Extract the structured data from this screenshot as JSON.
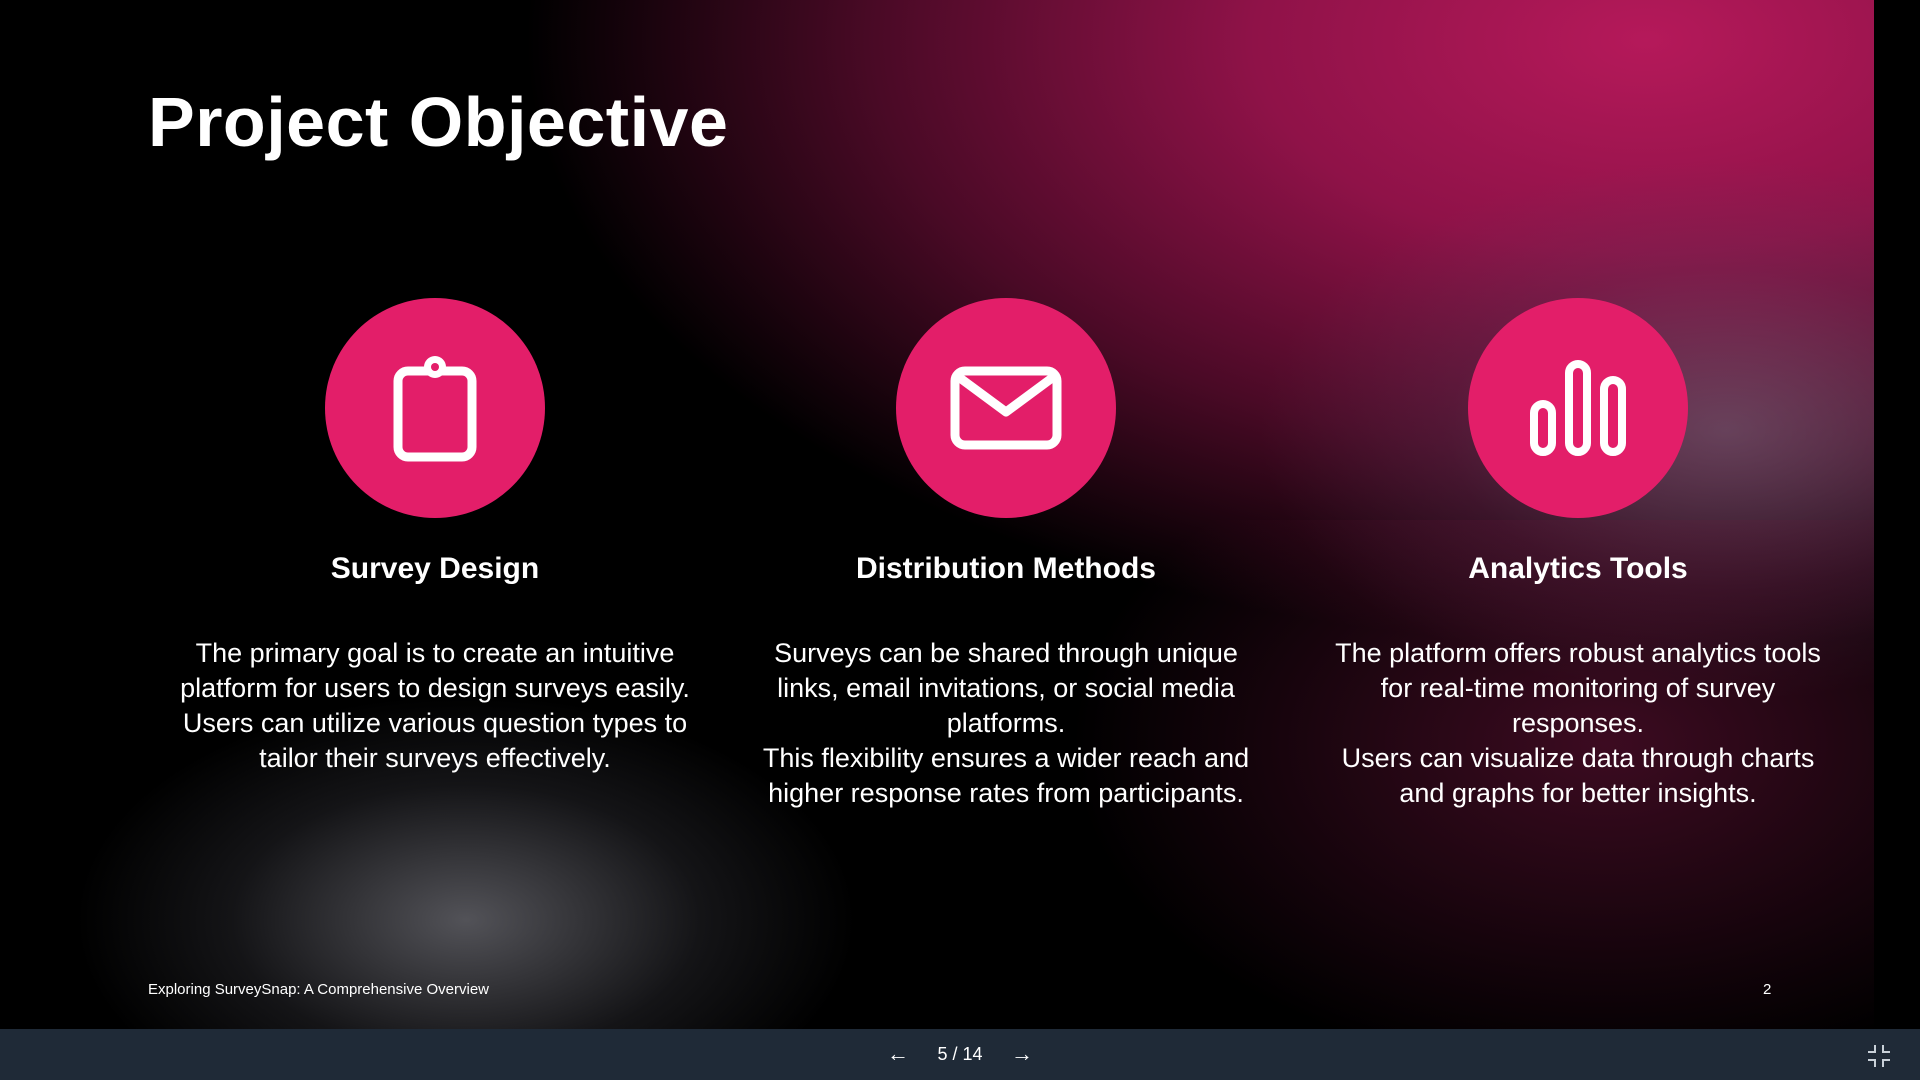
{
  "slide": {
    "title": "Project Objective",
    "columns": [
      {
        "icon": "clipboard-icon",
        "heading": "Survey Design",
        "paragraphs": [
          "The primary goal is to create an intuitive platform for users to design surveys easily.",
          "Users can utilize various question types to tailor their surveys effectively."
        ]
      },
      {
        "icon": "envelope-icon",
        "heading": "Distribution Methods",
        "paragraphs": [
          "Surveys can be shared through unique links, email invitations, or social media platforms.",
          "This flexibility ensures a wider reach and higher response rates from participants."
        ]
      },
      {
        "icon": "bar-chart-icon",
        "heading": "Analytics Tools",
        "paragraphs": [
          "The platform offers robust analytics tools for real-time monitoring of survey responses.",
          "Users can visualize data through charts and graphs for better insights."
        ]
      }
    ],
    "footer_text": "Exploring SurveySnap: A Comprehensive Overview",
    "page_number": "2"
  },
  "navigation": {
    "prev_label": "←",
    "next_label": "→",
    "counter": "5 / 14",
    "exit_fullscreen_icon": "exit-fullscreen-icon"
  },
  "colors": {
    "accent": "#e31e69",
    "navbar": "#1f2a37",
    "text": "#ffffff"
  }
}
